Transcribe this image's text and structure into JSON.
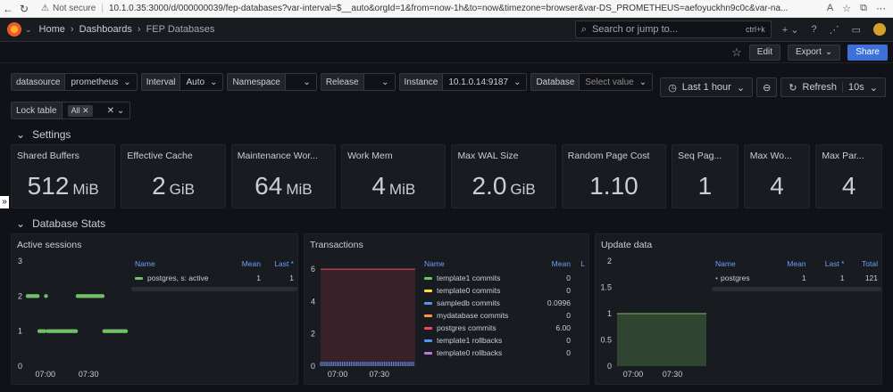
{
  "browser": {
    "security": "Not secure",
    "url": "10.1.0.35:3000/d/000000039/fep-databases?var-interval=$__auto&orgId=1&from=now-1h&to=now&timezone=browser&var-DS_PROMETHEUS=aefoyuckhn9c0c&var-na..."
  },
  "topnav": {
    "home": "Home",
    "dashboards": "Dashboards",
    "current": "FEP Databases",
    "search_placeholder": "Search or jump to...",
    "search_shortcut": "ctrl+k"
  },
  "toolbar": {
    "edit": "Edit",
    "export": "Export",
    "share": "Share"
  },
  "variables": [
    {
      "label": "datasource",
      "value": "prometheus"
    },
    {
      "label": "Interval",
      "value": "Auto"
    },
    {
      "label": "Namespace",
      "value": ""
    },
    {
      "label": "Release",
      "value": ""
    },
    {
      "label": "Instance",
      "value": "10.1.0.14:9187"
    },
    {
      "label": "Database",
      "value": "Select value"
    }
  ],
  "lock_table": {
    "label": "Lock table",
    "chip": "All"
  },
  "time": {
    "range": "Last 1 hour",
    "refresh": "Refresh",
    "interval": "10s"
  },
  "rows": {
    "settings": "Settings",
    "database_stats": "Database Stats"
  },
  "stats": [
    {
      "title": "Shared Buffers",
      "value": "512",
      "unit": "MiB"
    },
    {
      "title": "Effective Cache",
      "value": "2",
      "unit": "GiB"
    },
    {
      "title": "Maintenance Wor...",
      "value": "64",
      "unit": "MiB"
    },
    {
      "title": "Work Mem",
      "value": "4",
      "unit": "MiB"
    },
    {
      "title": "Max WAL Size",
      "value": "2.0",
      "unit": "GiB"
    },
    {
      "title": "Random Page Cost",
      "value": "1.10",
      "unit": ""
    },
    {
      "title": "Seq Pag...",
      "value": "1",
      "unit": ""
    },
    {
      "title": "Max Wo...",
      "value": "4",
      "unit": ""
    },
    {
      "title": "Max Par...",
      "value": "4",
      "unit": ""
    }
  ],
  "colors": {
    "green": "#73bf69",
    "yellow": "#fade2a",
    "blue": "#5794f2",
    "orange": "#ff9830",
    "red": "#f2495c",
    "purple": "#b877d9",
    "accent": "#3d71d9"
  },
  "chart_data": [
    {
      "type": "scatter",
      "title": "Active sessions",
      "x_ticks": [
        "07:00",
        "07:30"
      ],
      "y_ticks": [
        "0",
        "1",
        "2",
        "3"
      ],
      "ylim": [
        0,
        3
      ],
      "series": [
        {
          "name": "postgres, s: active",
          "mean": "1",
          "last": "1",
          "color": "#73bf69",
          "points_note": "value 1 across full hour with periods at 2",
          "x": [
            0,
            1,
            2,
            3,
            4,
            5,
            6,
            7,
            8,
            9,
            10,
            11,
            12,
            13,
            14,
            15,
            16,
            17,
            18,
            19,
            20,
            21,
            22,
            23,
            24,
            25,
            26,
            27,
            28,
            29,
            30,
            31,
            32,
            33,
            34,
            35,
            36,
            37,
            38,
            39,
            40,
            41,
            42,
            43,
            44,
            45,
            46,
            47,
            48,
            49,
            50,
            51,
            52,
            53,
            54,
            55,
            56,
            57,
            58,
            59
          ],
          "y": [
            2,
            2,
            2,
            2,
            2,
            2,
            2,
            1,
            1,
            1,
            1,
            2,
            1,
            1,
            1,
            1,
            1,
            1,
            1,
            1,
            1,
            1,
            1,
            1,
            1,
            1,
            1,
            1,
            1,
            1,
            2,
            2,
            2,
            2,
            2,
            2,
            2,
            2,
            2,
            2,
            2,
            2,
            2,
            2,
            2,
            2,
            1,
            1,
            1,
            1,
            1,
            1,
            1,
            1,
            1,
            1,
            1,
            1,
            1,
            1
          ]
        }
      ],
      "legend_headers": [
        "Name",
        "Mean",
        "Last *"
      ]
    },
    {
      "type": "area",
      "title": "Transactions",
      "x_ticks": [
        "07:00",
        "07:30"
      ],
      "y_ticks": [
        "0",
        "2",
        "4",
        "6"
      ],
      "ylim": [
        0,
        6.5
      ],
      "threshold": 6,
      "legend_headers": [
        "Name",
        "Mean",
        "L"
      ],
      "series": [
        {
          "name": "template1 commits",
          "mean": "0",
          "color": "#73bf69"
        },
        {
          "name": "template0 commits",
          "mean": "0",
          "color": "#fade2a"
        },
        {
          "name": "sampledb commits",
          "mean": "0.0996",
          "color": "#5794f2"
        },
        {
          "name": "mydatabase commits",
          "mean": "0",
          "color": "#ff9830"
        },
        {
          "name": "postgres commits",
          "mean": "6.00",
          "color": "#f2495c"
        },
        {
          "name": "template1 rollbacks",
          "mean": "0",
          "color": "#5794f2"
        },
        {
          "name": "template0 rollbacks",
          "mean": "0",
          "color": "#b877d9"
        }
      ]
    },
    {
      "type": "area",
      "title": "Update data",
      "x_ticks": [
        "07:00",
        "07:30"
      ],
      "y_ticks": [
        "0",
        "0.5",
        "1",
        "1.5",
        "2"
      ],
      "ylim": [
        0,
        2
      ],
      "legend_headers": [
        "Name",
        "Mean",
        "Last *",
        "Total"
      ],
      "series": [
        {
          "name": "postgres",
          "mean": "1",
          "last": "1",
          "total": "121",
          "color": "#73bf69",
          "value": 1
        }
      ]
    }
  ]
}
